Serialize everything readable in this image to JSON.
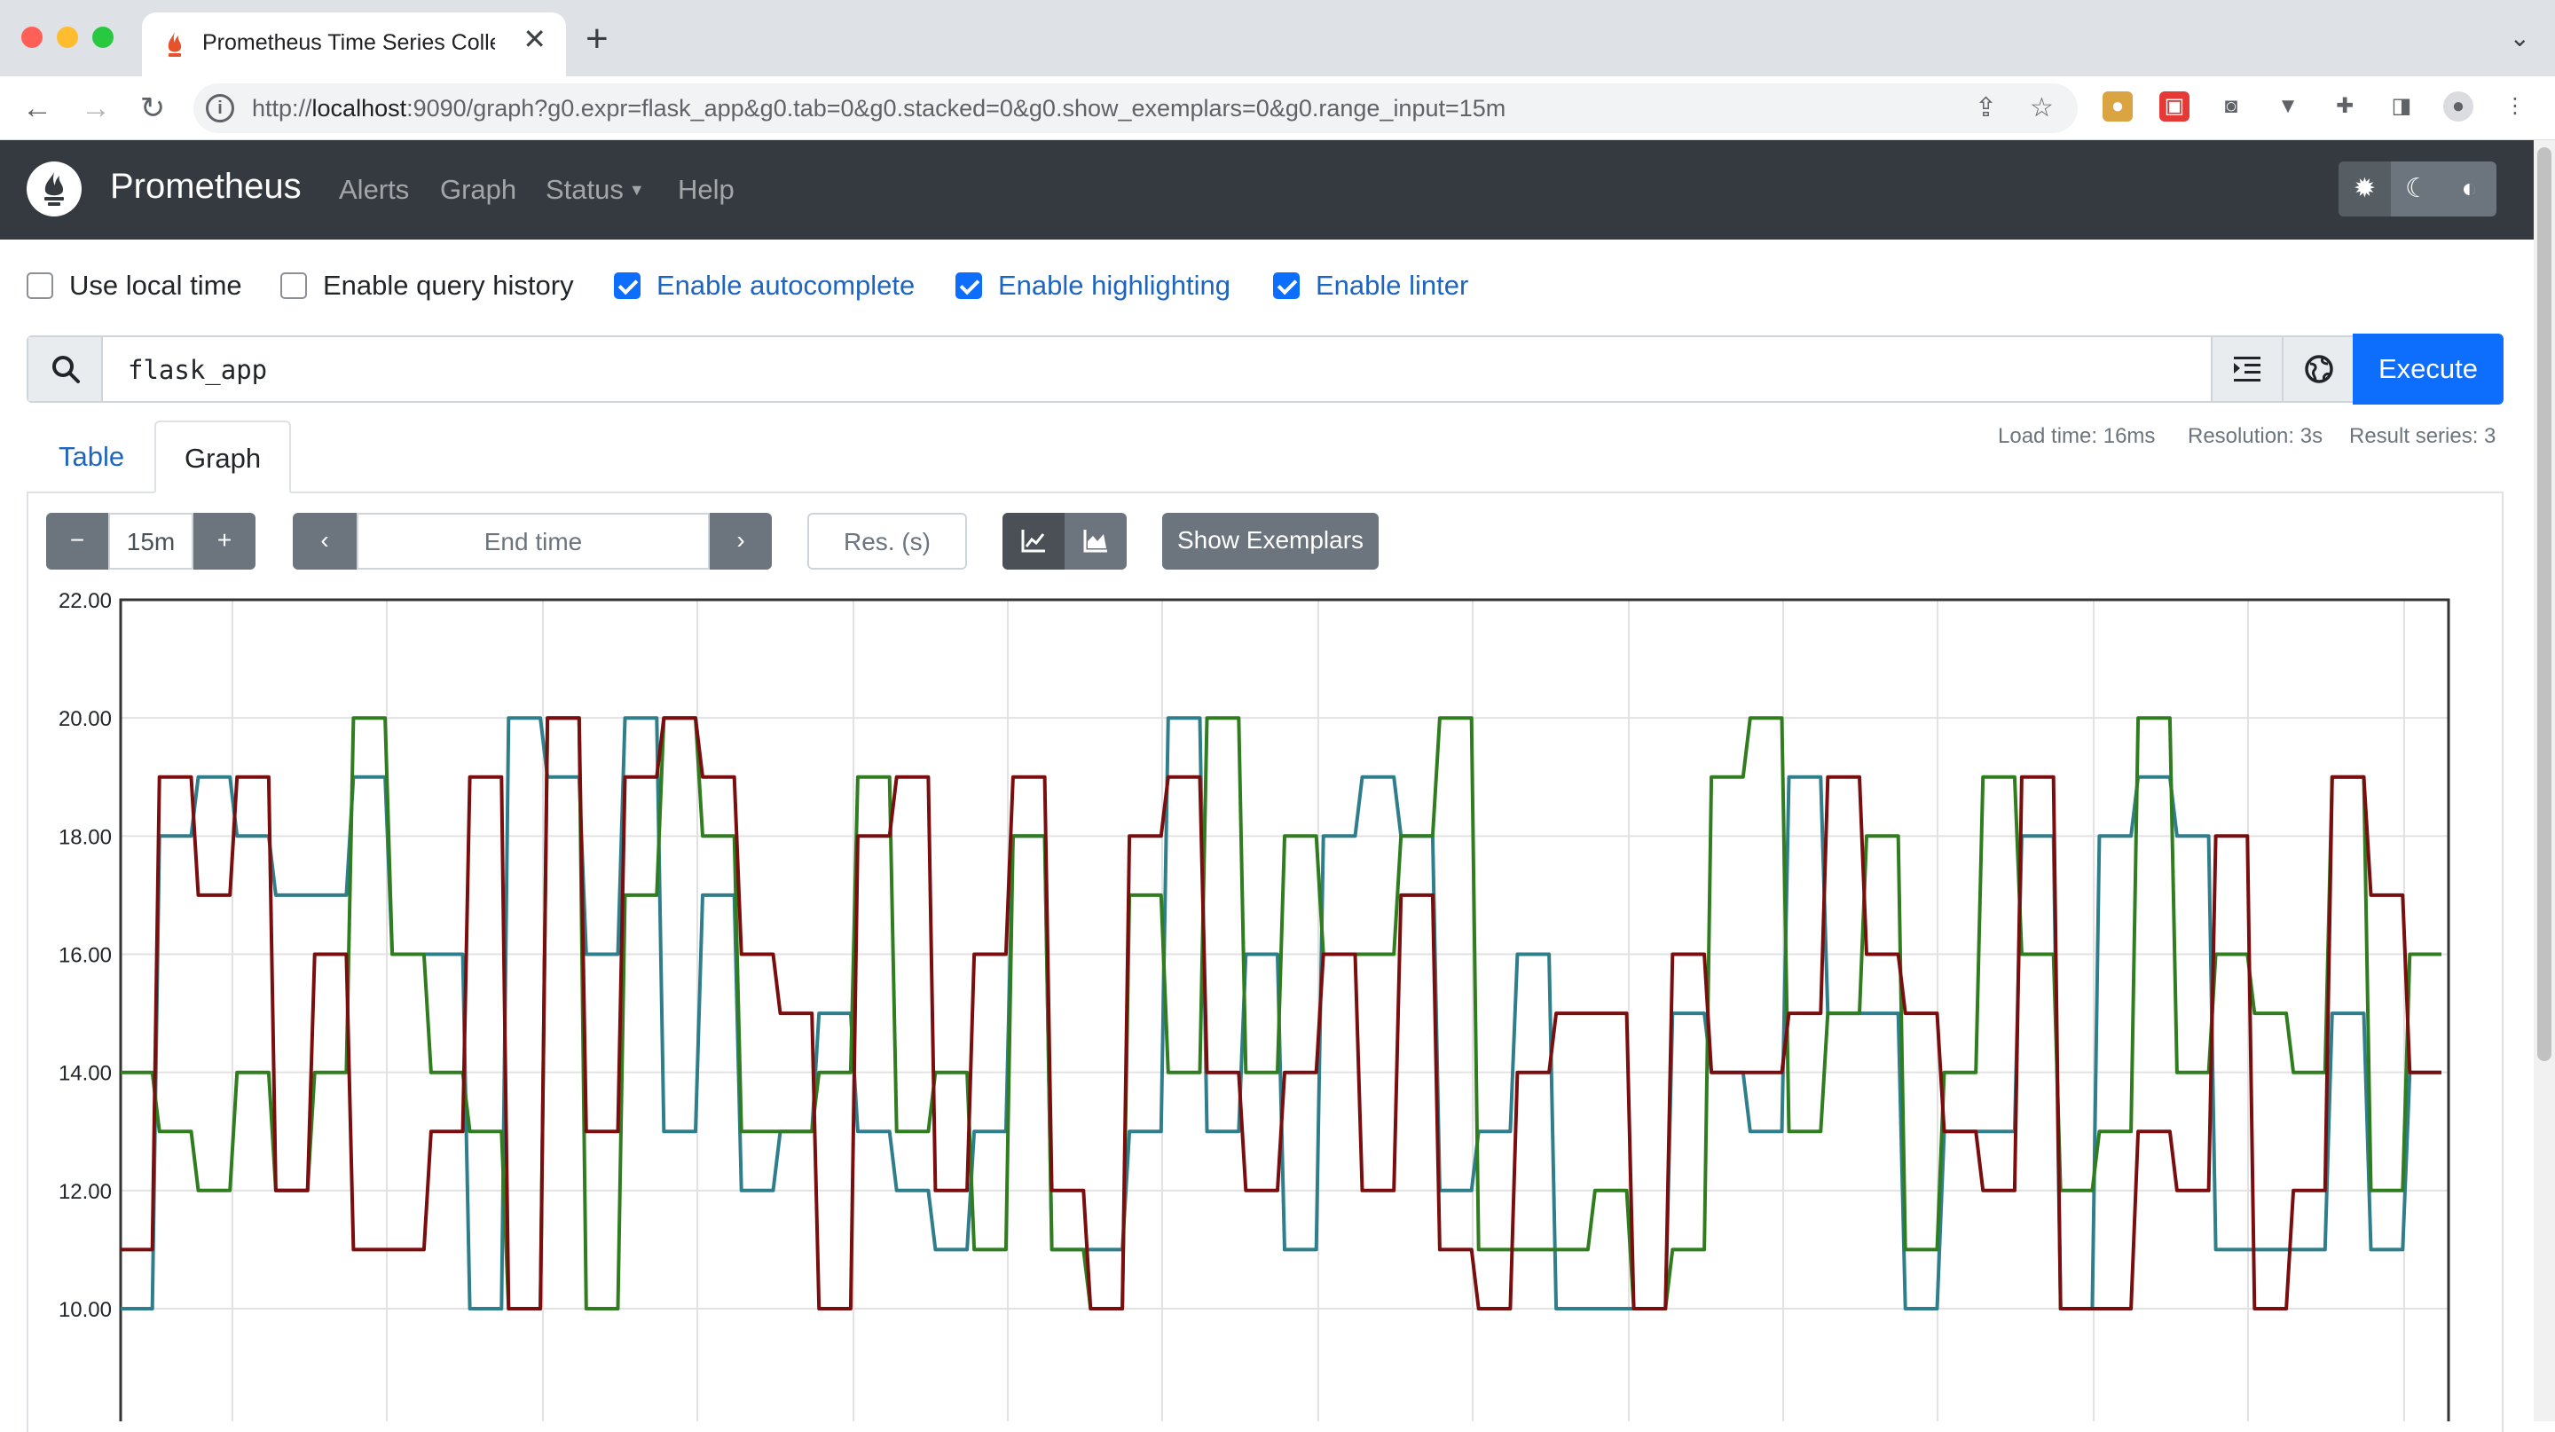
{
  "browser": {
    "tab_title": "Prometheus Time Series Collec",
    "url_prefix": "http://",
    "url_host": "localhost",
    "url_rest": ":9090/graph?g0.expr=flask_app&g0.tab=0&g0.stacked=0&g0.show_exemplars=0&g0.range_input=15m"
  },
  "navbar": {
    "brand": "Prometheus",
    "links": [
      "Alerts",
      "Graph",
      "Status",
      "Help"
    ]
  },
  "options": [
    {
      "label": "Use local time",
      "checked": false
    },
    {
      "label": "Enable query history",
      "checked": false
    },
    {
      "label": "Enable autocomplete",
      "checked": true
    },
    {
      "label": "Enable highlighting",
      "checked": true
    },
    {
      "label": "Enable linter",
      "checked": true
    }
  ],
  "query": {
    "expression": "flask_app",
    "execute_label": "Execute"
  },
  "panel": {
    "tabs": [
      "Table",
      "Graph"
    ],
    "active_tab": "Graph",
    "load_time": "Load time: 16ms",
    "resolution": "Resolution: 3s",
    "result_series": "Result series: 3",
    "range": "15m",
    "end_time_placeholder": "End time",
    "res_placeholder": "Res. (s)",
    "show_exemplars_label": "Show Exemplars"
  },
  "colors": {
    "navbar": "#343a40",
    "primary": "#0d6efd",
    "series_teal": "#2e7e8c",
    "series_green": "#2f7d1f",
    "series_red": "#7a0d0d"
  },
  "chart_data": {
    "type": "line",
    "step": true,
    "ylim": [
      9,
      22
    ],
    "yticks": [
      "22.00",
      "20.00",
      "18.00",
      "16.00",
      "14.00",
      "12.00",
      "10.00"
    ],
    "grid": true,
    "series": [
      {
        "color": "#2e7e8c",
        "values": [
          10,
          18,
          19,
          18,
          17,
          17,
          19,
          16,
          16,
          10,
          20,
          19,
          16,
          20,
          13,
          17,
          12,
          13,
          15,
          13,
          12,
          11,
          13,
          18,
          11,
          11,
          13,
          20,
          13,
          16,
          11,
          18,
          19,
          18,
          12,
          13,
          16,
          10,
          10,
          10,
          15,
          14,
          13,
          19,
          15,
          15,
          10,
          13,
          13,
          18,
          10,
          18,
          19,
          18,
          11,
          11,
          11,
          15,
          11,
          14
        ]
      },
      {
        "color": "#2f7d1f",
        "values": [
          14,
          13,
          12,
          14,
          12,
          14,
          20,
          16,
          14,
          13,
          10,
          20,
          10,
          17,
          20,
          18,
          13,
          13,
          14,
          19,
          13,
          14,
          11,
          18,
          11,
          10,
          17,
          14,
          20,
          14,
          18,
          16,
          16,
          18,
          20,
          11,
          11,
          11,
          12,
          10,
          11,
          19,
          20,
          13,
          15,
          18,
          11,
          14,
          19,
          16,
          12,
          13,
          20,
          14,
          16,
          15,
          14,
          19,
          12,
          16
        ]
      },
      {
        "color": "#7a0d0d",
        "values": [
          11,
          19,
          17,
          19,
          12,
          16,
          11,
          11,
          13,
          19,
          10,
          20,
          13,
          19,
          20,
          19,
          16,
          15,
          10,
          18,
          19,
          12,
          16,
          19,
          12,
          10,
          18,
          19,
          14,
          12,
          14,
          16,
          12,
          17,
          11,
          10,
          14,
          15,
          15,
          10,
          16,
          14,
          14,
          15,
          19,
          16,
          15,
          13,
          12,
          19,
          10,
          10,
          13,
          12,
          18,
          10,
          12,
          19,
          17,
          14
        ]
      }
    ]
  }
}
